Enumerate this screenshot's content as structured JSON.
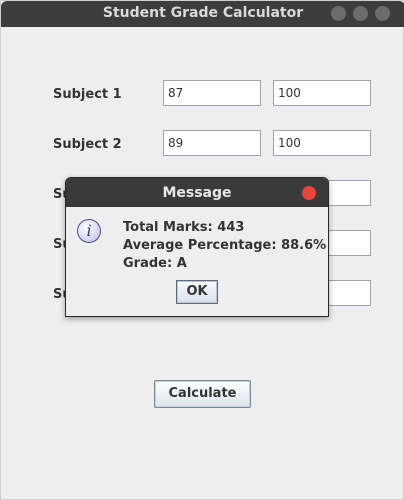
{
  "window": {
    "title": "Student Grade Calculator"
  },
  "subjects": [
    {
      "label": "Subject 1",
      "marks": "87",
      "max": "100"
    },
    {
      "label": "Subject 2",
      "marks": "89",
      "max": "100"
    },
    {
      "label": "Su",
      "marks": "",
      "max": ""
    },
    {
      "label": "Su",
      "marks": "",
      "max": ""
    },
    {
      "label": "Su",
      "marks": "",
      "max": ""
    }
  ],
  "calculate_label": "Calculate",
  "dialog": {
    "title": "Message",
    "icon": "info-icon",
    "icon_glyph": "i",
    "lines": [
      "Total Marks: 443",
      "Average Percentage: 88.6%",
      "Grade: A"
    ],
    "ok_label": "OK"
  },
  "colors": {
    "titlebar": "#3d3d3d",
    "dialog_close": "#e8453c",
    "window_bg": "#eeeeee"
  }
}
